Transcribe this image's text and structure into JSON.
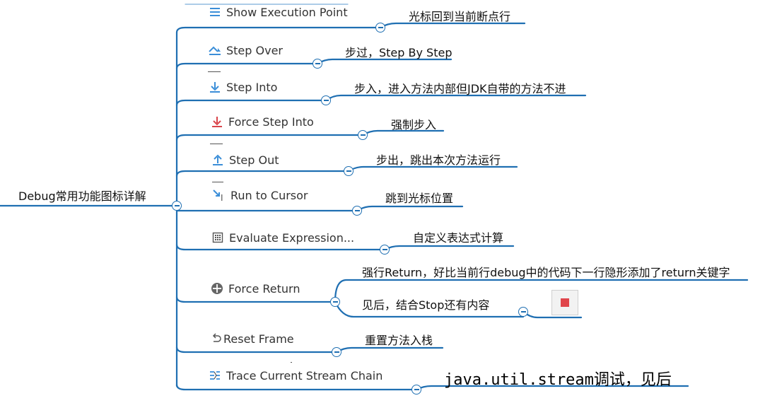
{
  "root": {
    "label": "Debug常用功能图标详解"
  },
  "items": [
    {
      "label": "Show Execution Point",
      "icon": "show-execution-point-icon",
      "desc": "光标回到当前断点行"
    },
    {
      "label": "Step Over",
      "icon": "step-over-icon",
      "desc": "步过，Step By Step"
    },
    {
      "label": "Step Into",
      "icon": "step-into-icon",
      "desc": "步入，进入方法内部但JDK自带的方法不进"
    },
    {
      "label": "Force Step Into",
      "icon": "force-step-into-icon",
      "desc": "强制步入"
    },
    {
      "label": "Step Out",
      "icon": "step-out-icon",
      "desc": "步出，跳出本次方法运行"
    },
    {
      "label": "Run to Cursor",
      "icon": "run-to-cursor-icon",
      "desc": "跳到光标位置"
    },
    {
      "label": "Evaluate Expression...",
      "icon": "calculator-icon",
      "desc": "自定义表达式计算"
    },
    {
      "label": "Force Return",
      "icon": "force-return-icon",
      "desc": "强行Return，好比当前行debug中的代码下一行隐形添加了return关键字",
      "desc2": "见后，结合Stop还有内容"
    },
    {
      "label": "Reset Frame",
      "icon": "reset-frame-icon",
      "desc": "重置方法入栈"
    },
    {
      "label": "Trace Current Stream Chain",
      "icon": "trace-stream-icon",
      "desc": "java.util.stream调试，见后"
    }
  ],
  "colors": {
    "line": "#1f6fb2",
    "stop": "#e0454b",
    "icon_blue": "#3b8ed8",
    "icon_red": "#d9444a"
  }
}
